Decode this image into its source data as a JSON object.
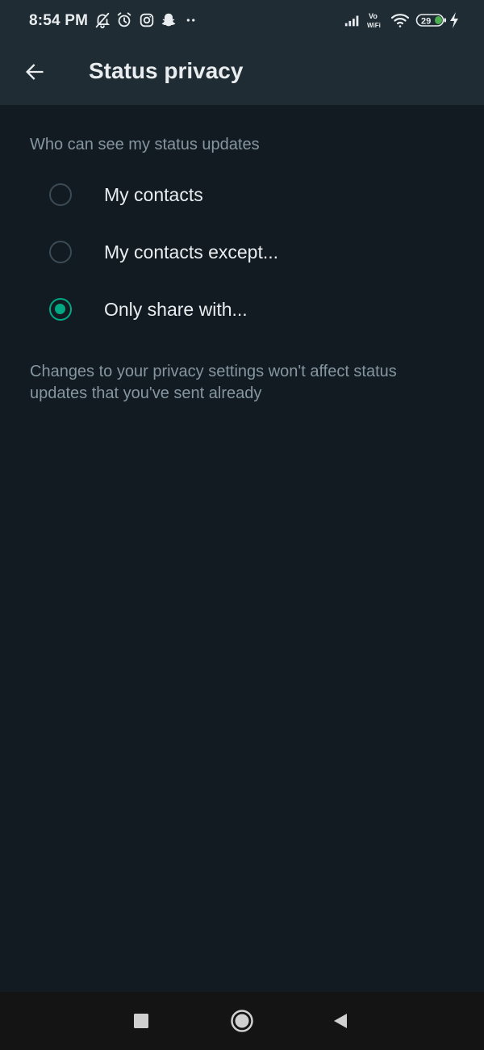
{
  "status_bar": {
    "time": "8:54 PM",
    "battery": "29",
    "network_label": "Vo WiFi",
    "left_icons": [
      "bell-off-icon",
      "alarm-icon",
      "instagram-icon",
      "snapchat-icon",
      "more-dots-icon"
    ],
    "right_icons": [
      "signal-icon",
      "vowifi-icon",
      "wifi-icon",
      "battery-icon",
      "charging-icon"
    ]
  },
  "app_bar": {
    "title": "Status privacy",
    "back_icon": "arrow-left-icon"
  },
  "privacy": {
    "section_header": "Who can see my status updates",
    "options": [
      {
        "label": "My contacts",
        "selected": false
      },
      {
        "label": "My contacts except...",
        "selected": false
      },
      {
        "label": "Only share with...",
        "selected": true
      }
    ],
    "footnote": "Changes to your privacy settings won't affect status updates that you've sent already"
  },
  "nav_bar": {
    "buttons": [
      "recents-square-icon",
      "home-circle-icon",
      "back-triangle-icon"
    ]
  },
  "colors": {
    "background": "#121b22",
    "bar": "#1f2c34",
    "accent": "#00a884",
    "primary_text": "#e9edef",
    "secondary_text": "#8696a0"
  }
}
